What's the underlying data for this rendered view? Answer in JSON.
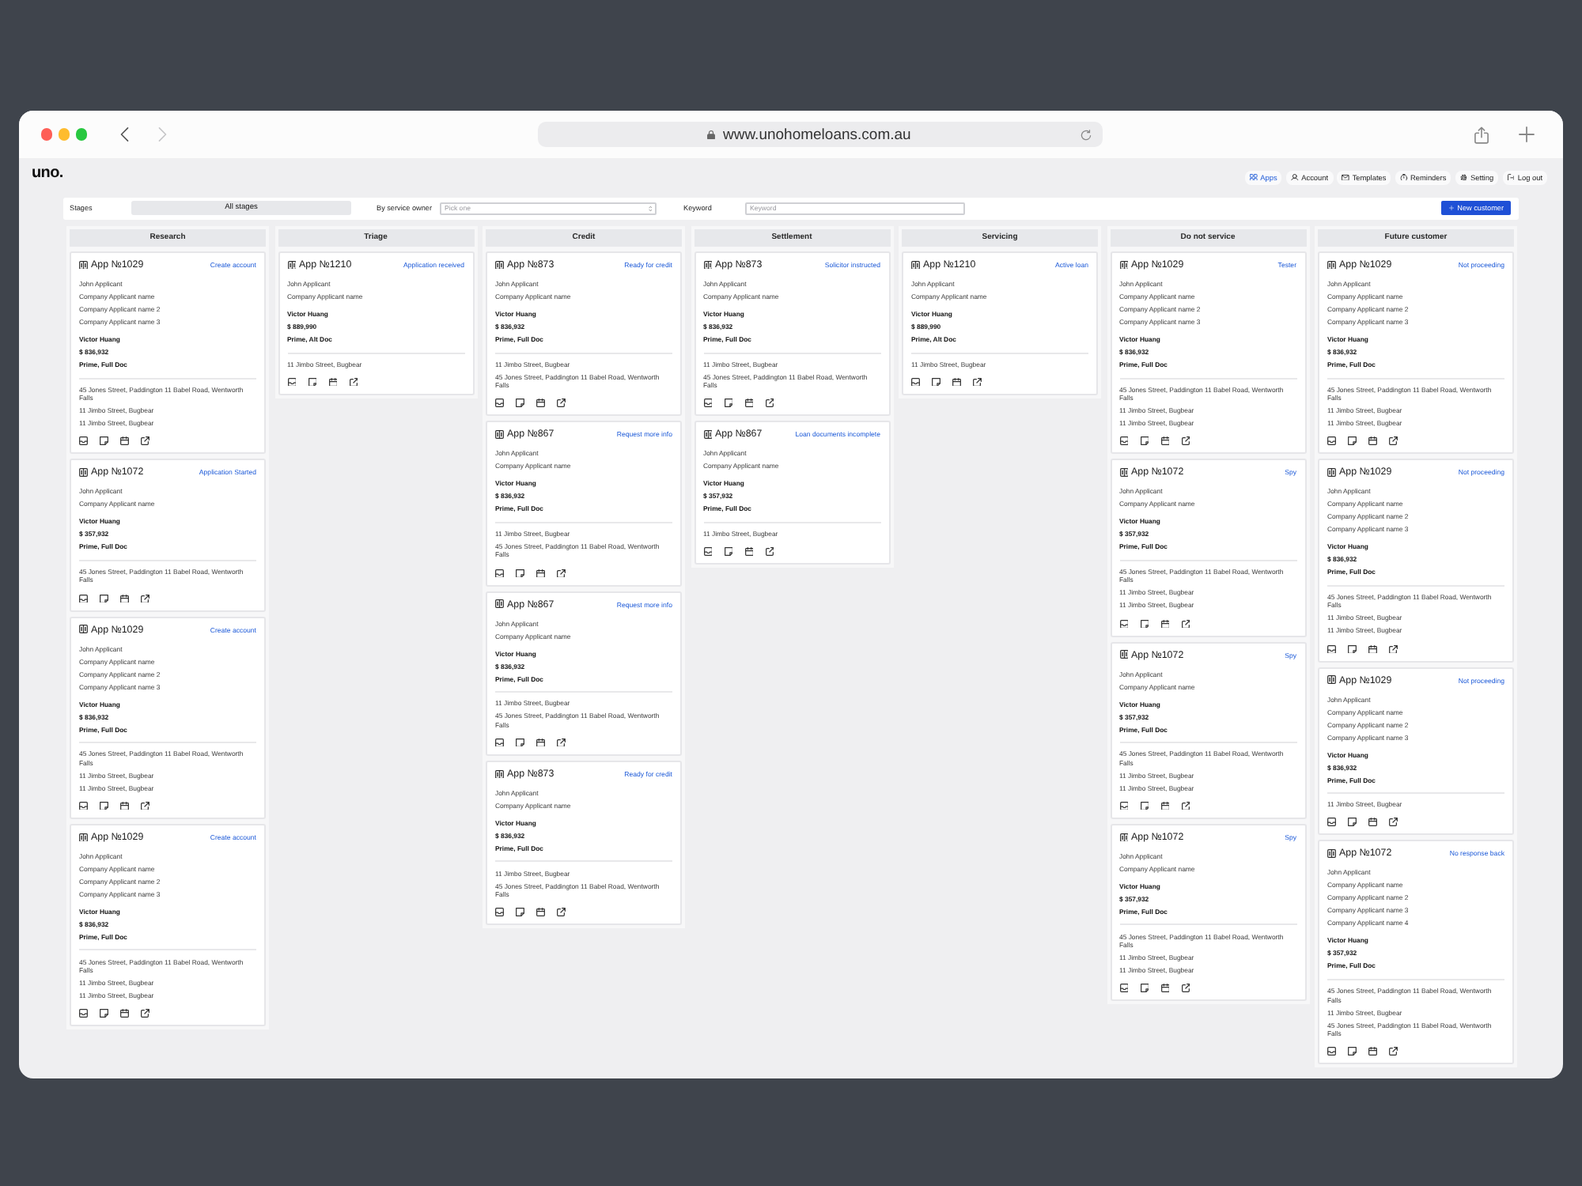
{
  "browser": {
    "url": "www.unohomeloans.com.au"
  },
  "header": {
    "logo": "uno.",
    "nav": [
      {
        "label": "Apps",
        "selected": true
      },
      {
        "label": "Account",
        "selected": false
      },
      {
        "label": "Templates",
        "selected": false
      },
      {
        "label": "Reminders",
        "selected": false
      },
      {
        "label": "Setting",
        "selected": false
      },
      {
        "label": "Log out",
        "selected": false
      }
    ]
  },
  "filters": {
    "stages": {
      "label": "Stages",
      "value": "All stages"
    },
    "service_owner": {
      "label": "By service owner",
      "placeholder": "Pick one"
    },
    "keyword": {
      "label": "Keyword",
      "placeholder": "Keyword"
    },
    "new_customer_button": "New customer"
  },
  "columns": [
    {
      "title": "Research",
      "cards": [
        {
          "app": "App №1029",
          "status": "Create account",
          "applicants": [
            "John Applicant",
            "Company Applicant name",
            "Company Applicant name 2",
            "Company Applicant name 3"
          ],
          "broker": "Victor Huang",
          "amount": "$ 836,932",
          "product": "Prime, Full Doc",
          "addresses": [
            "45 Jones Street, Paddington 11 Babel Road, Wentworth Falls",
            "11 Jimbo Street, Bugbear",
            "11 Jimbo Street, Bugbear"
          ]
        },
        {
          "app": "App №1072",
          "status": "Application Started",
          "applicants": [
            "John Applicant",
            "Company Applicant name"
          ],
          "broker": "Victor Huang",
          "amount": "$ 357,932",
          "product": "Prime, Full Doc",
          "addresses": [
            "45 Jones Street, Paddington 11 Babel Road, Wentworth Falls"
          ]
        },
        {
          "app": "App №1029",
          "status": "Create account",
          "applicants": [
            "John Applicant",
            "Company Applicant name",
            "Company Applicant name 2",
            "Company Applicant name 3"
          ],
          "broker": "Victor Huang",
          "amount": "$ 836,932",
          "product": "Prime, Full Doc",
          "addresses": [
            "45 Jones Street, Paddington 11 Babel Road, Wentworth Falls",
            "11 Jimbo Street, Bugbear",
            "11 Jimbo Street, Bugbear"
          ]
        },
        {
          "app": "App №1029",
          "status": "Create account",
          "applicants": [
            "John Applicant",
            "Company Applicant name",
            "Company Applicant name 2",
            "Company Applicant name 3"
          ],
          "broker": "Victor Huang",
          "amount": "$ 836,932",
          "product": "Prime, Full Doc",
          "addresses": [
            "45 Jones Street, Paddington 11 Babel Road, Wentworth Falls",
            "11 Jimbo Street, Bugbear",
            "11 Jimbo Street, Bugbear"
          ]
        }
      ]
    },
    {
      "title": "Triage",
      "cards": [
        {
          "app": "App №1210",
          "status": "Application received",
          "applicants": [
            "John Applicant",
            "Company Applicant name"
          ],
          "broker": "Victor Huang",
          "amount": "$ 889,990",
          "product": "Prime, Alt Doc",
          "addresses": [
            "11 Jimbo Street, Bugbear"
          ]
        }
      ]
    },
    {
      "title": "Credit",
      "cards": [
        {
          "app": "App №873",
          "status": "Ready for credit",
          "applicants": [
            "John Applicant",
            "Company Applicant name"
          ],
          "broker": "Victor Huang",
          "amount": "$ 836,932",
          "product": "Prime, Full Doc",
          "addresses": [
            "11 Jimbo Street, Bugbear",
            "45 Jones Street, Paddington 11 Babel Road, Wentworth Falls"
          ]
        },
        {
          "app": "App №867",
          "status": "Request more info",
          "applicants": [
            "John Applicant",
            "Company Applicant name"
          ],
          "broker": "Victor Huang",
          "amount": "$ 836,932",
          "product": "Prime, Full Doc",
          "addresses": [
            "11 Jimbo Street, Bugbear",
            "45 Jones Street, Paddington 11 Babel Road, Wentworth Falls"
          ]
        },
        {
          "app": "App №867",
          "status": "Request more info",
          "applicants": [
            "John Applicant",
            "Company Applicant name"
          ],
          "broker": "Victor Huang",
          "amount": "$ 836,932",
          "product": "Prime, Full Doc",
          "addresses": [
            "11 Jimbo Street, Bugbear",
            "45 Jones Street, Paddington 11 Babel Road, Wentworth Falls"
          ]
        },
        {
          "app": "App №873",
          "status": "Ready for credit",
          "applicants": [
            "John Applicant",
            "Company Applicant name"
          ],
          "broker": "Victor Huang",
          "amount": "$ 836,932",
          "product": "Prime, Full Doc",
          "addresses": [
            "11 Jimbo Street, Bugbear",
            "45 Jones Street, Paddington 11 Babel Road, Wentworth Falls"
          ]
        }
      ]
    },
    {
      "title": "Settlement",
      "cards": [
        {
          "app": "App №873",
          "status": "Solicitor instructed",
          "applicants": [
            "John Applicant",
            "Company Applicant name"
          ],
          "broker": "Victor Huang",
          "amount": "$ 836,932",
          "product": "Prime, Full Doc",
          "addresses": [
            "11 Jimbo Street, Bugbear",
            "45 Jones Street, Paddington 11 Babel Road, Wentworth Falls"
          ]
        },
        {
          "app": "App №867",
          "status": "Loan documents incomplete",
          "applicants": [
            "John Applicant",
            "Company Applicant name"
          ],
          "broker": "Victor Huang",
          "amount": "$ 357,932",
          "product": "Prime, Full Doc",
          "addresses": [
            "11 Jimbo Street, Bugbear"
          ]
        }
      ]
    },
    {
      "title": "Servicing",
      "cards": [
        {
          "app": "App №1210",
          "status": "Active loan",
          "applicants": [
            "John Applicant",
            "Company Applicant name"
          ],
          "broker": "Victor Huang",
          "amount": "$ 889,990",
          "product": "Prime, Alt Doc",
          "addresses": [
            "11 Jimbo Street, Bugbear"
          ]
        }
      ]
    },
    {
      "title": "Do not service",
      "cards": [
        {
          "app": "App №1029",
          "status": "Tester",
          "applicants": [
            "John Applicant",
            "Company Applicant name",
            "Company Applicant name 2",
            "Company Applicant name 3"
          ],
          "broker": "Victor Huang",
          "amount": "$ 836,932",
          "product": "Prime, Full Doc",
          "addresses": [
            "45 Jones Street, Paddington 11 Babel Road, Wentworth Falls",
            "11 Jimbo Street, Bugbear",
            "11 Jimbo Street, Bugbear"
          ]
        },
        {
          "app": "App №1072",
          "status": "Spy",
          "applicants": [
            "John Applicant",
            "Company Applicant name"
          ],
          "broker": "Victor Huang",
          "amount": "$ 357,932",
          "product": "Prime, Full Doc",
          "addresses": [
            "45 Jones Street, Paddington 11 Babel Road, Wentworth Falls",
            "11 Jimbo Street, Bugbear",
            "11 Jimbo Street, Bugbear"
          ]
        },
        {
          "app": "App №1072",
          "status": "Spy",
          "applicants": [
            "John Applicant",
            "Company Applicant name"
          ],
          "broker": "Victor Huang",
          "amount": "$ 357,932",
          "product": "Prime, Full Doc",
          "addresses": [
            "45 Jones Street, Paddington 11 Babel Road, Wentworth Falls",
            "11 Jimbo Street, Bugbear",
            "11 Jimbo Street, Bugbear"
          ]
        },
        {
          "app": "App №1072",
          "status": "Spy",
          "applicants": [
            "John Applicant",
            "Company Applicant name"
          ],
          "broker": "Victor Huang",
          "amount": "$ 357,932",
          "product": "Prime, Full Doc",
          "addresses": [
            "45 Jones Street, Paddington 11 Babel Road, Wentworth Falls",
            "11 Jimbo Street, Bugbear",
            "11 Jimbo Street, Bugbear"
          ]
        }
      ]
    },
    {
      "title": "Future customer",
      "cards": [
        {
          "app": "App №1029",
          "status": "Not proceeding",
          "applicants": [
            "John Applicant",
            "Company Applicant name",
            "Company Applicant name 2",
            "Company Applicant name 3"
          ],
          "broker": "Victor Huang",
          "amount": "$ 836,932",
          "product": "Prime, Full Doc",
          "addresses": [
            "45 Jones Street, Paddington 11 Babel Road, Wentworth Falls",
            "11 Jimbo Street, Bugbear",
            "11 Jimbo Street, Bugbear"
          ]
        },
        {
          "app": "App №1029",
          "status": "Not proceeding",
          "applicants": [
            "John Applicant",
            "Company Applicant name",
            "Company Applicant name 2",
            "Company Applicant name 3"
          ],
          "broker": "Victor Huang",
          "amount": "$ 836,932",
          "product": "Prime, Full Doc",
          "addresses": [
            "45 Jones Street, Paddington 11 Babel Road, Wentworth Falls",
            "11 Jimbo Street, Bugbear",
            "11 Jimbo Street, Bugbear"
          ]
        },
        {
          "app": "App №1029",
          "status": "Not proceeding",
          "applicants": [
            "John Applicant",
            "Company Applicant name",
            "Company Applicant name 2",
            "Company Applicant name 3"
          ],
          "broker": "Victor Huang",
          "amount": "$ 836,932",
          "product": "Prime, Full Doc",
          "addresses": [
            "11 Jimbo Street, Bugbear"
          ]
        },
        {
          "app": "App №1072",
          "status": "No response back",
          "applicants": [
            "John Applicant",
            "Company Applicant name",
            "Company Applicant name 2",
            "Company Applicant name 3",
            "Company Applicant name 4"
          ],
          "broker": "Victor Huang",
          "amount": "$ 357,932",
          "product": "Prime, Full Doc",
          "addresses": [
            "45 Jones Street, Paddington 11 Babel Road, Wentworth Falls",
            "11 Jimbo Street, Bugbear",
            "45 Jones Street, Paddington 11 Babel Road, Wentworth Falls"
          ]
        }
      ]
    }
  ]
}
